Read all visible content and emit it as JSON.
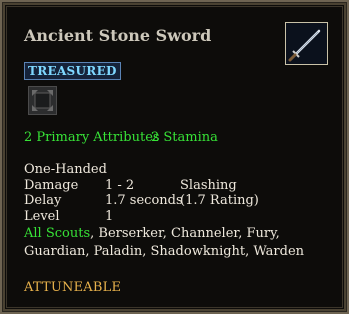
{
  "item": {
    "name": "Ancient Stone Sword",
    "tier": "TREASURED",
    "icon": "sword-icon",
    "slot_icon": "slot-icon"
  },
  "attributes": {
    "primary": "2 Primary Attributes",
    "stamina": "2 Stamina"
  },
  "weapon": {
    "type": "One-Handed",
    "damage_label": "Damage",
    "damage_value": "1 - 2",
    "damage_type": "Slashing",
    "delay_label": "Delay",
    "delay_value": "1.7 seconds",
    "delay_rating": "(1.7 Rating)",
    "level_label": "Level",
    "level_value": "1"
  },
  "classes": {
    "highlight": "All Scouts",
    "rest": ", Berserker, Channeler, Fury, Guardian, Paladin, Shadowknight, Warden"
  },
  "footer": {
    "attune": "ATTUNEABLE"
  },
  "colors": {
    "green": "#37e237",
    "gold": "#e8b24c",
    "tier_blue": "#7fd8ff"
  }
}
